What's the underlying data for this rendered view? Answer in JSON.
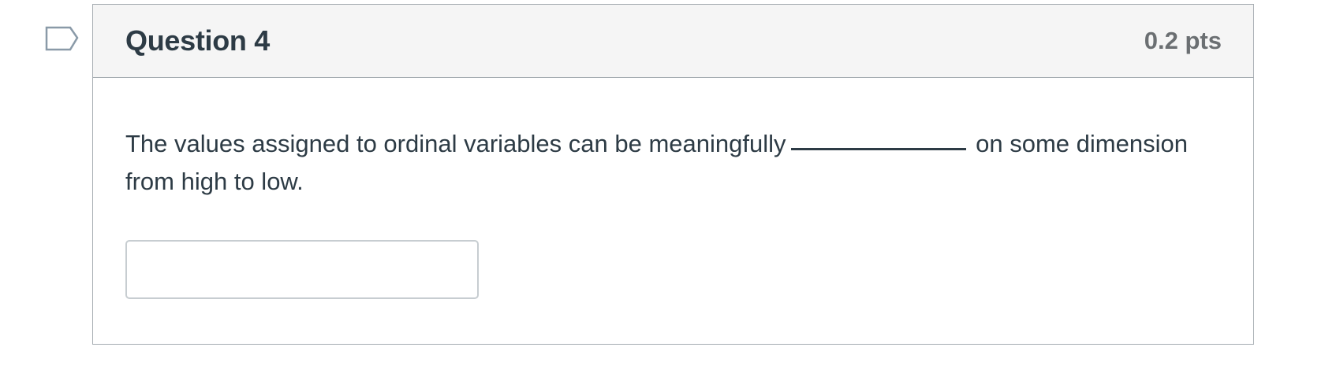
{
  "question": {
    "title": "Question 4",
    "points": "0.2 pts",
    "text_before_blank": "The values assigned to ordinal variables can be meaningfully",
    "text_after_blank": "on some dimension from high to low.",
    "answer": {
      "value": "",
      "placeholder": ""
    }
  },
  "colors": {
    "header_background": "#f5f5f5",
    "border": "#a5acb1",
    "text": "#2d3b45",
    "points_text": "#6b6f72",
    "flag_outline": "#8a9aa8"
  },
  "icons": {
    "flag": "flag-question-icon"
  }
}
